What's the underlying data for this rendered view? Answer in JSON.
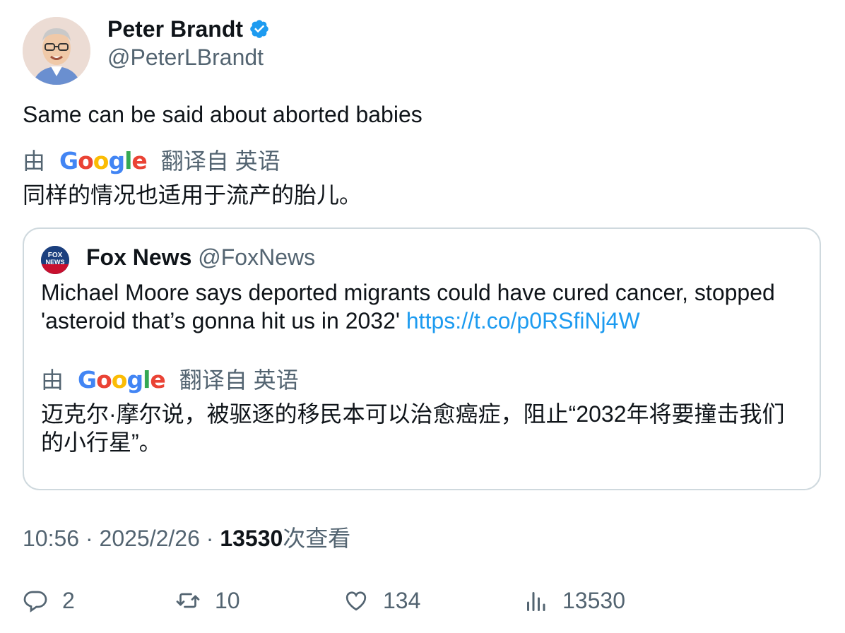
{
  "author": {
    "name": "Peter Brandt",
    "handle": "@PeterLBrandt"
  },
  "tweet": {
    "text": "Same can be said about aborted babies",
    "translate_by": "由",
    "translate_from": "翻译自 英语",
    "translation": "同样的情况也适用于流产的胎儿。"
  },
  "quote": {
    "name": "Fox News",
    "handle": "@FoxNews",
    "text_line1": "Michael Moore says deported migrants could have cured cancer, stopped",
    "text_line2": "'asteroid that’s gonna hit us in 2032'",
    "link": "https://t.co/p0RSfiNj4W",
    "translate_by": "由",
    "translate_from": "翻译自 英语",
    "translation_line1": "迈克尔·摩尔说，被驱逐的移民本可以治愈癌症，阻止“2032年将要撞击我们",
    "translation_line2": "的小行星”。"
  },
  "meta": {
    "time": "10:56",
    "sep": "·",
    "date": "2025/2/26",
    "views_count": "13530",
    "views_label": "次查看"
  },
  "actions": {
    "replies": "2",
    "retweets": "10",
    "likes": "134",
    "views": "13530"
  },
  "colors": {
    "link": "#1d9bf0",
    "verified": "#1d9bf0",
    "secondary_text": "#536471"
  }
}
